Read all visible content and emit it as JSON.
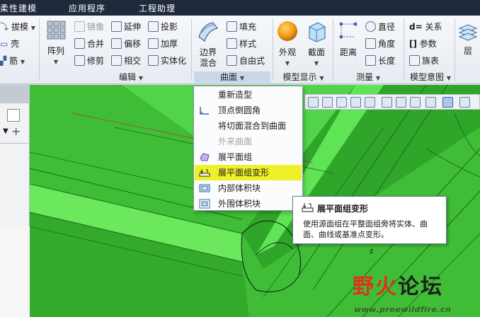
{
  "menu_tabs": [
    "柔性建模",
    "应用程序",
    "工程助理"
  ],
  "ribbon": {
    "left_column": [
      "拔模",
      "壳",
      "筋"
    ],
    "array_label": "阵列",
    "edit_items": [
      "镜像",
      "延伸",
      "投影",
      "合并",
      "偏移",
      "加厚",
      "修剪",
      "相交",
      "实体化"
    ],
    "edit_group": "编辑",
    "boundary_blend_label": "边界\n混合",
    "surface_items": [
      "填充",
      "样式",
      "自由式"
    ],
    "surface_group": "曲面",
    "appearance_label": "外观",
    "section_label": "截面",
    "model_display_group": "模型显示",
    "distance_label": "距离",
    "measure_items": [
      "直径",
      "角度",
      "长度"
    ],
    "measure_group": "测量",
    "intent_items": [
      "关系",
      "参数",
      "族表"
    ],
    "intent_group": "模型意图",
    "layer_label": "层"
  },
  "dropdown": {
    "items": [
      {
        "label": "重新造型",
        "icon": "none",
        "disabled": false,
        "highlighted": false
      },
      {
        "label": "顶点倒圆角",
        "icon": "vertex-round-icon",
        "disabled": false,
        "highlighted": false
      },
      {
        "label": "将切面混合到曲面",
        "icon": "none",
        "disabled": false,
        "highlighted": false
      },
      {
        "label": "外来曲面",
        "icon": "none",
        "disabled": true,
        "highlighted": false
      },
      {
        "label": "展平面组",
        "icon": "flatten-quilt-icon",
        "disabled": false,
        "highlighted": false
      },
      {
        "label": "展平面组变形",
        "icon": "flatten-deform-icon",
        "disabled": false,
        "highlighted": true
      },
      {
        "label": "内部体积块",
        "icon": "inner-volume-icon",
        "disabled": false,
        "highlighted": false
      },
      {
        "label": "外围体积块",
        "icon": "outer-volume-icon",
        "disabled": false,
        "highlighted": false
      }
    ]
  },
  "tooltip": {
    "title": "展平面组变形",
    "body": "使用源面组在平整面组旁将实体、曲面、曲线或基准点变形。"
  },
  "watermark": {
    "logo_part1": "野火",
    "logo_part2": "论坛",
    "url": "www.proewildfire.cn"
  },
  "colors": {
    "menubar_bg": "#1f2a3d",
    "viewport_green": "#42c23a",
    "highlight_yellow": "#eef12a",
    "active_group_label": "#c8d7e9"
  }
}
